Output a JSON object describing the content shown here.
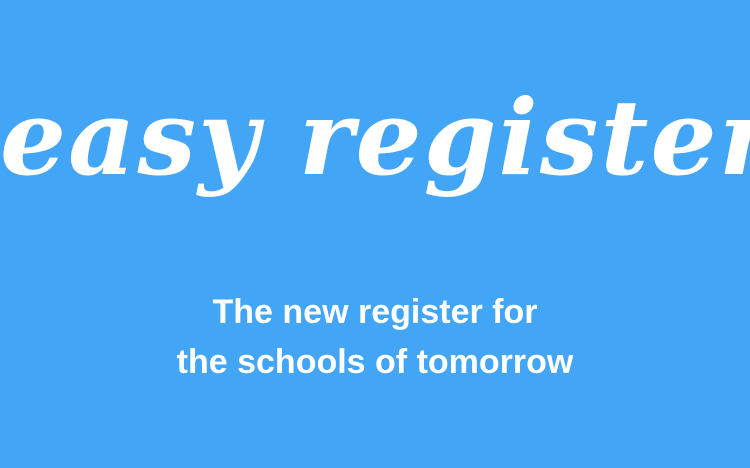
{
  "colors": {
    "background": "#42a5f5",
    "text": "#ffffff"
  },
  "logo": {
    "text": "easy register"
  },
  "tagline": {
    "line1": "The new register for",
    "line2": "the schools of tomorrow"
  }
}
